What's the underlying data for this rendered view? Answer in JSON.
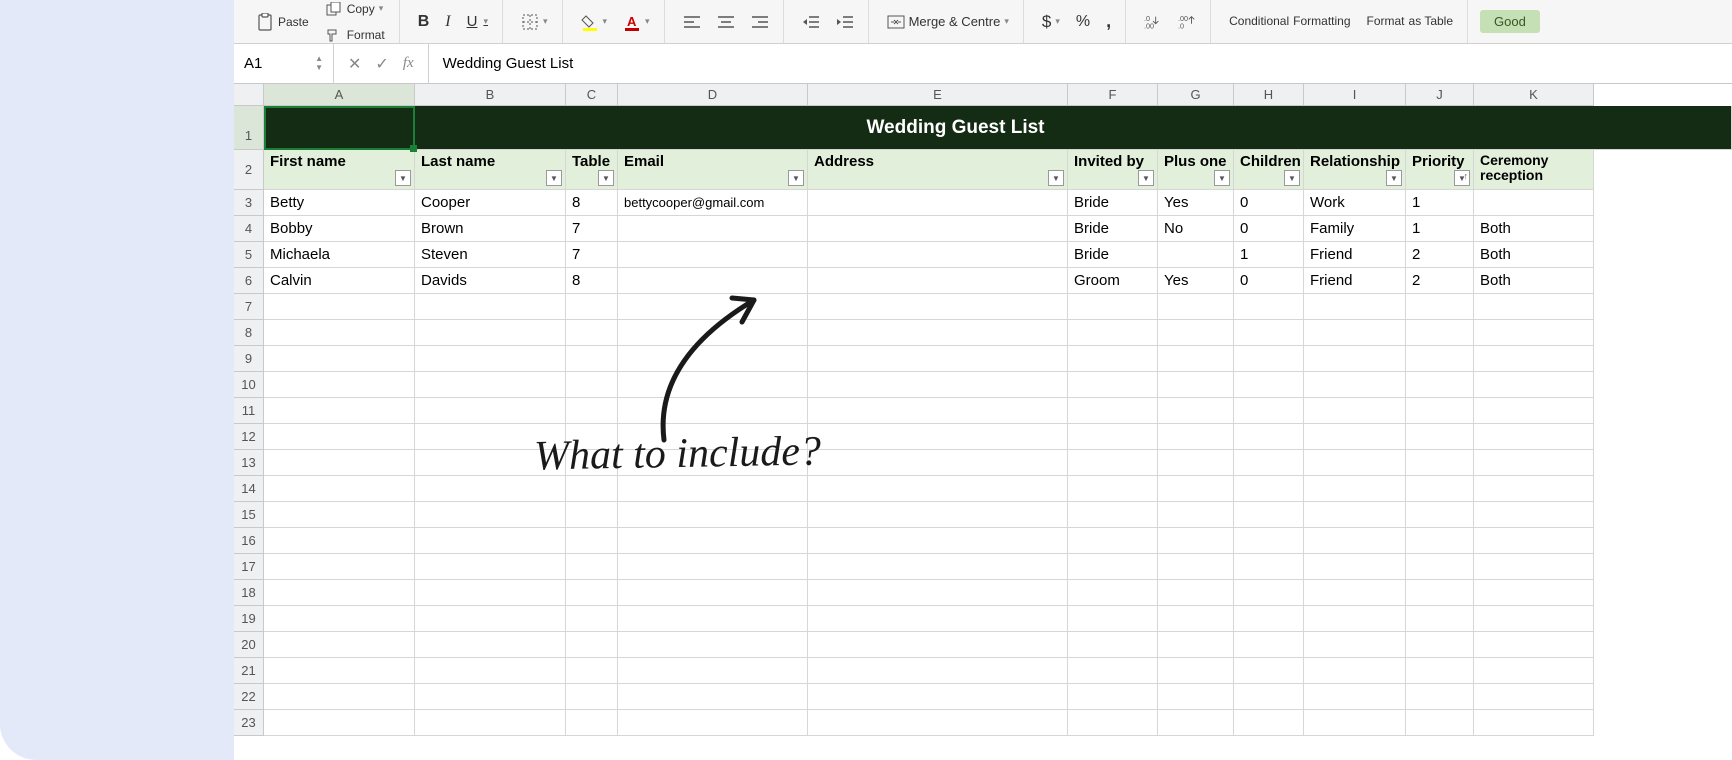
{
  "toolbar": {
    "paste": "Paste",
    "copy": "Copy",
    "format_painter": "Format",
    "bold": "B",
    "italic": "I",
    "underline": "U",
    "merge": "Merge & Centre",
    "currency": "$",
    "percent": "%",
    "comma": ",",
    "inc_dec": ".0",
    "dec_dec": ".00",
    "conditional": "Conditional",
    "conditional2": "Formatting",
    "format_table": "Format",
    "format_table2": "as Table",
    "good": "Good"
  },
  "name_box": "A1",
  "formula_value": "Wedding Guest List",
  "columns": [
    "A",
    "B",
    "C",
    "D",
    "E",
    "F",
    "G",
    "H",
    "I",
    "J",
    "K"
  ],
  "title": "Wedding Guest List",
  "headers": {
    "first_name": "First name",
    "last_name": "Last name",
    "table": "Table",
    "email": "Email",
    "address": "Address",
    "invited_by": "Invited by",
    "plus_one": "Plus one",
    "children": "Children",
    "relationship": "Relationship",
    "priority": "Priority",
    "ceremony": "Ceremony reception"
  },
  "rows": [
    {
      "first": "Betty",
      "last": "Cooper",
      "table": "8",
      "email": "bettycooper@gmail.com",
      "address": "",
      "invited": "Bride",
      "plus": "Yes",
      "children": "0",
      "rel": "Work",
      "priority": "1",
      "ceremony": ""
    },
    {
      "first": "Bobby",
      "last": "Brown",
      "table": "7",
      "email": "",
      "address": "",
      "invited": "Bride",
      "plus": "No",
      "children": "0",
      "rel": "Family",
      "priority": "1",
      "ceremony": "Both"
    },
    {
      "first": "Michaela",
      "last": "Steven",
      "table": "7",
      "email": "",
      "address": "",
      "invited": "Bride",
      "plus": "",
      "children": "1",
      "rel": "Friend",
      "priority": "2",
      "ceremony": "Both"
    },
    {
      "first": "Calvin",
      "last": "Davids",
      "table": "8",
      "email": "",
      "address": "",
      "invited": "Groom",
      "plus": "Yes",
      "children": "0",
      "rel": "Friend",
      "priority": "2",
      "ceremony": "Both"
    }
  ],
  "row_numbers": [
    "1",
    "2",
    "3",
    "4",
    "5",
    "6",
    "7",
    "8",
    "9",
    "10",
    "11",
    "12",
    "13",
    "14",
    "15",
    "16",
    "17",
    "18",
    "19",
    "20",
    "21",
    "22",
    "23"
  ],
  "annotation": "What to include?"
}
